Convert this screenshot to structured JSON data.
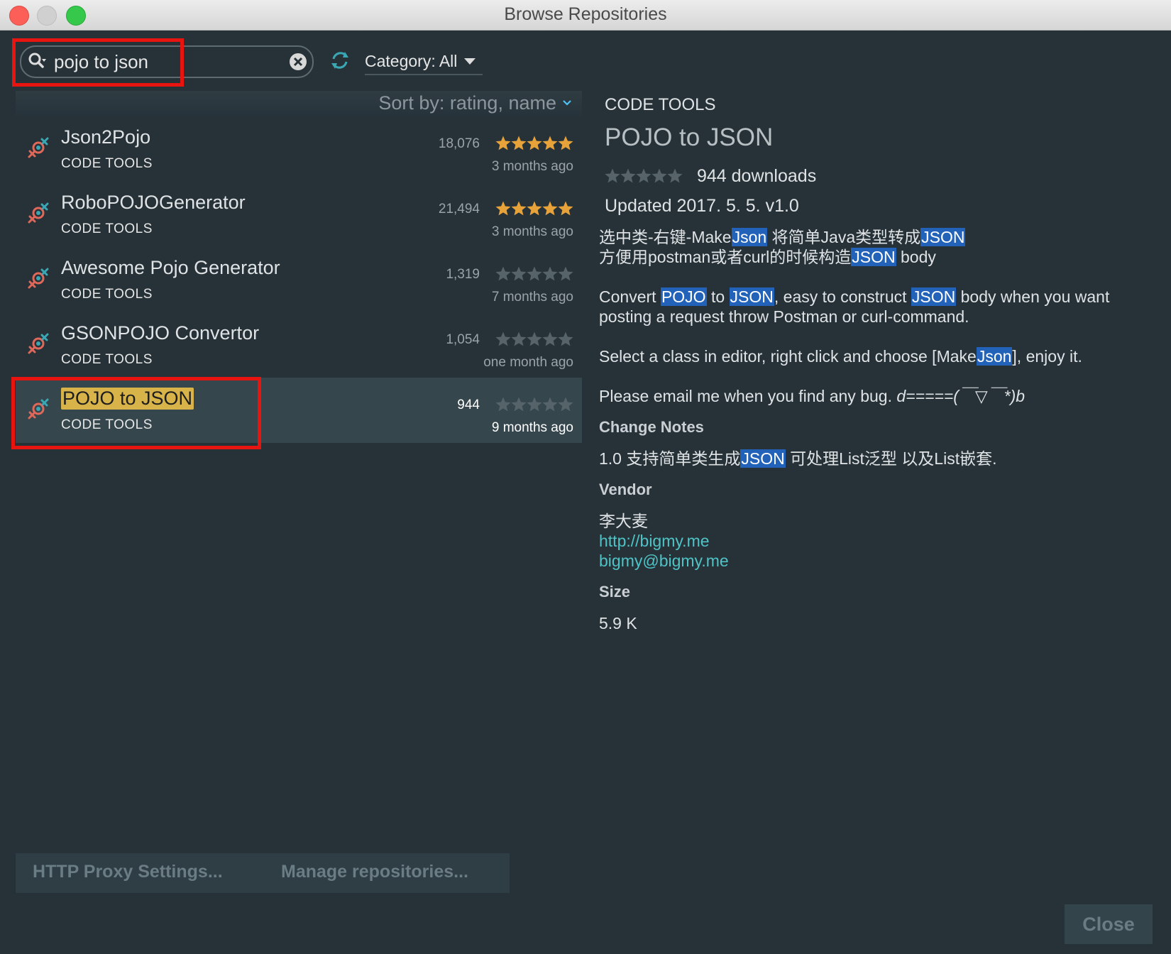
{
  "window": {
    "title": "Browse Repositories"
  },
  "toolbar": {
    "search_value": "pojo to json",
    "category_label": "Category: All"
  },
  "list": {
    "sort_label": "Sort by: rating, name",
    "items": [
      {
        "name": "Json2Pojo",
        "category": "CODE TOOLS",
        "downloads": "18,076",
        "rating": 5,
        "date": "3 months ago",
        "selected": false
      },
      {
        "name": "RoboPOJOGenerator",
        "category": "CODE TOOLS",
        "downloads": "21,494",
        "rating": 5,
        "date": "3 months ago",
        "selected": false
      },
      {
        "name": "Awesome Pojo Generator",
        "category": "CODE TOOLS",
        "downloads": "1,319",
        "rating": 0,
        "date": "7 months ago",
        "selected": false
      },
      {
        "name": "GSONPOJO Convertor",
        "category": "CODE TOOLS",
        "downloads": "1,054",
        "rating": 0,
        "date": "one month ago",
        "selected": false
      },
      {
        "name": "POJO to JSON",
        "category": "CODE TOOLS",
        "downloads": "944",
        "rating": 0,
        "date": "9 months ago",
        "selected": true
      }
    ]
  },
  "detail": {
    "category": "CODE TOOLS",
    "title": "POJO to JSON",
    "rating": 0,
    "downloads": "944 downloads",
    "updated": "Updated 2017. 5. 5.   v1.0",
    "desc_cn_1a": "选中类-右键-Make",
    "desc_cn_1b": "Json",
    "desc_cn_1c": " 将简单Java类型转成",
    "desc_cn_1d": "JSON",
    "desc_cn_2a": "方便用postman或者curl的时候构造",
    "desc_cn_2b": "JSON",
    "desc_cn_2c": " body",
    "desc_en_1a": "Convert ",
    "desc_en_1b": "POJO",
    "desc_en_1c": " to ",
    "desc_en_1d": "JSON",
    "desc_en_1e": ", easy to construct ",
    "desc_en_1f": "JSON",
    "desc_en_1g": " body when you want posting a request throw Postman or curl-command.",
    "desc_en_2a": "Select a class in editor, right click and choose [Make",
    "desc_en_2b": "Json",
    "desc_en_2c": "], enjoy it.",
    "desc_en_3a": "Please email me when you find any bug. ",
    "desc_en_3b": "d=====(￣▽￣*)b",
    "change_notes_heading": "Change Notes",
    "change_notes_a": "1.0 支持简单类生成",
    "change_notes_b": "JSON",
    "change_notes_c": " 可处理List泛型 以及List嵌套.",
    "vendor_heading": "Vendor",
    "vendor_name": "李大麦",
    "vendor_url": "http://bigmy.me",
    "vendor_email": "bigmy@bigmy.me",
    "size_heading": "Size",
    "size_value": "5.9 K"
  },
  "bottom": {
    "proxy_label": "HTTP Proxy Settings...",
    "manage_label": "Manage repositories...",
    "close_label": "Close"
  },
  "colors": {
    "background": "#263238",
    "highlight_red": "#e8140f",
    "match_blue": "#2262b8",
    "search_match_yellow": "#d7b34a",
    "star_orange": "#e8a23a",
    "link_teal": "#4fc3c6"
  }
}
